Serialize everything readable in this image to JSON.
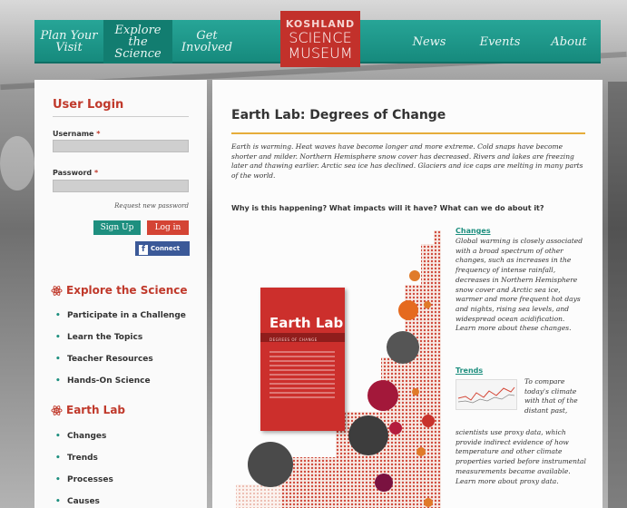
{
  "nav": {
    "items": [
      {
        "label_line1": "Plan Your",
        "label_line2": "Visit"
      },
      {
        "label_line1": "Explore",
        "label_line2": "the",
        "label_line3": "Science"
      },
      {
        "label_line1": "Get",
        "label_line2": "Involved"
      },
      {
        "label": "News"
      },
      {
        "label": "Events"
      },
      {
        "label": "About"
      }
    ],
    "logo": {
      "line1": "KOSHLAND",
      "line2": "SCIENCE",
      "line3": "MUSEUM"
    }
  },
  "login": {
    "title": "User Login",
    "username_label": "Username",
    "password_label": "Password",
    "required_mark": "*",
    "request_password": "Request new password",
    "signup_label": "Sign Up",
    "login_label": "Log in",
    "connect_label": "Connect",
    "fb_letter": "f"
  },
  "explore": {
    "title": "Explore the Science",
    "items": [
      "Participate in a Challenge",
      "Learn the Topics",
      "Teacher Resources",
      "Hands-On Science"
    ]
  },
  "earthlab_menu": {
    "title": "Earth Lab",
    "items": [
      "Changes",
      "Trends",
      "Processes",
      "Causes"
    ]
  },
  "main": {
    "title": "Earth Lab: Degrees of Change",
    "intro": "Earth is warming. Heat waves have become longer and more extreme. Cold snaps have become shorter and milder. Northern Hemisphere snow cover has decreased. Rivers and lakes are freezing later and thawing earlier. Arctic sea ice has declined. Glaciers and ice caps are melting in many parts of the world.",
    "question": "Why is this happening? What impacts will it have? What can we do about it?",
    "book_title": "Earth Lab",
    "book_subtitle": "DEGREES OF CHANGE",
    "changes": {
      "link": "Changes",
      "text": "Global warming is closely associated with a broad spectrum of other changes, such as increases in the frequency of intense rainfall, decreases in Northern Hemisphere snow cover and Arctic sea ice, warmer and more frequent hot days and nights, rising sea levels, and widespread ocean acidification. Learn more about these changes."
    },
    "trends": {
      "link": "Trends",
      "text_short": "To compare today's climate with that of the distant past,",
      "text_rest": "scientists use proxy data, which provide indirect evidence of how temperature and other climate properties varied before instrumental measurements became available. Learn more about proxy data."
    }
  },
  "colors": {
    "nav_teal": "#1b9889",
    "accent_red": "#c0392b",
    "title_rule": "#e6ad3a",
    "facebook": "#3b5998"
  }
}
